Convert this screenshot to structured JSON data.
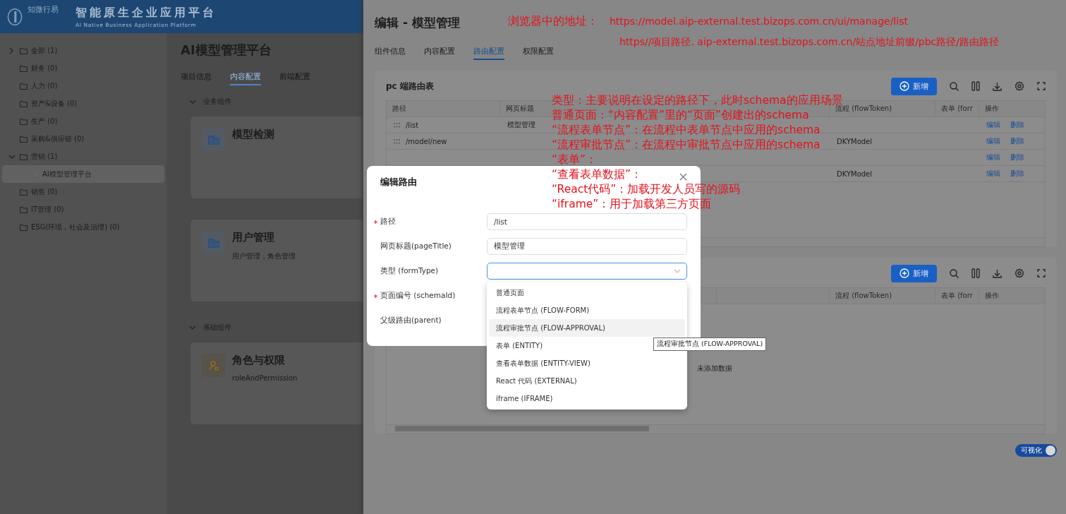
{
  "app_header": {
    "brand": "知微行易",
    "title": "智能原生企业应用平台",
    "subtitle": "AI Native Business Application Platform"
  },
  "sidebar": {
    "items": [
      {
        "label": "全部 (1)",
        "expanded": false
      },
      {
        "label": "财务 (0)"
      },
      {
        "label": "人力 (0)"
      },
      {
        "label": "资产&设备 (0)"
      },
      {
        "label": "生产 (0)"
      },
      {
        "label": "采购&供应链 (0)"
      },
      {
        "label": "营销 (1)",
        "expanded": true,
        "children": [
          {
            "label": "AI模型管理平台",
            "selected": true
          }
        ]
      },
      {
        "label": "销售 (0)"
      },
      {
        "label": "IT管理 (0)"
      },
      {
        "label": "ESG(环境，社会及治理) (0)"
      }
    ]
  },
  "page": {
    "title": "AI模型管理平台",
    "tabs": [
      {
        "label": "项目信息",
        "selected": false
      },
      {
        "label": "内容配置",
        "selected": true
      },
      {
        "label": "前端配置",
        "selected": false
      }
    ],
    "sections": [
      {
        "title": "业务组件",
        "expanded": true,
        "cards": [
          {
            "title": "模型检测"
          },
          {
            "title": "用户管理",
            "description": "用户管理，角色管理"
          }
        ]
      },
      {
        "title": "基础组件",
        "expanded": true,
        "cards": [
          {
            "title": "角色与权限",
            "description": "roleAndPermission"
          }
        ]
      }
    ]
  },
  "drawer": {
    "title": "编辑 - 模型管理",
    "tabs": [
      {
        "label": "组件信息",
        "selected": false
      },
      {
        "label": "内容配置",
        "selected": false
      },
      {
        "label": "路由配置",
        "selected": true
      },
      {
        "label": "权限配置",
        "selected": false
      }
    ],
    "route_tables": [
      {
        "title": "pc 端路由表",
        "add_button": "新增",
        "columns": [
          "路径",
          "网页标题",
          null,
          null,
          "流程 (flowToken)",
          "表单 (forr",
          "操作"
        ],
        "rows": [
          {
            "cells": [
              "/list",
              "模型管理",
              null,
              null,
              null,
              null
            ],
            "actions": [
              "编辑",
              "删除"
            ]
          },
          {
            "cells": [
              "/model/new",
              null,
              null,
              null,
              "DKYModel",
              null
            ],
            "actions": [
              "编辑",
              "删除"
            ]
          },
          {
            "cells": [
              null,
              null,
              null,
              null,
              null,
              null
            ],
            "actions": [
              "编辑",
              "删除"
            ]
          },
          {
            "cells": [
              null,
              null,
              null,
              null,
              "DKYModel",
              null
            ],
            "actions": [
              "编辑",
              "删除"
            ]
          }
        ]
      },
      {
        "add_button": "新增",
        "columns": [
          null,
          null,
          null,
          null,
          "流程 (flowToken)",
          "表单 (forr",
          "操作"
        ],
        "empty_text": "未添加数据"
      }
    ],
    "visual_toggle": {
      "label": "可视化",
      "on": true
    }
  },
  "modal": {
    "title": "编辑路由",
    "fields": [
      {
        "label": "路径",
        "required": true,
        "kind": "input",
        "value": "/list"
      },
      {
        "label": "网页标题(pageTitle)",
        "required": false,
        "kind": "input",
        "value": "模型管理"
      },
      {
        "label": "类型 (formType)",
        "required": false,
        "kind": "select",
        "focused": true
      },
      {
        "label": "页面编号 (schemaId)",
        "required": true
      },
      {
        "label": "父级路由(parent)",
        "required": false
      }
    ],
    "dropdown": {
      "options": [
        {
          "label": "普通页面",
          "hovered": false
        },
        {
          "label": "流程表单节点 (FLOW-FORM)",
          "hovered": false
        },
        {
          "label": "流程审批节点 (FLOW-APPROVAL)",
          "hovered": true
        },
        {
          "label": "表单 (ENTITY)",
          "hovered": false
        },
        {
          "label": "查看表单数据 (ENTITY-VIEW)",
          "hovered": false
        },
        {
          "label": "React 代码 (EXTERNAL)",
          "hovered": false
        },
        {
          "label": "iframe (IFRAME)",
          "hovered": false
        }
      ]
    },
    "tooltip": "流程审批节点 (FLOW-APPROVAL)"
  },
  "annotations": {
    "url_note": {
      "label": "浏览器中的地址：",
      "url": "https://model.aip-external.test.bizops.com.cn/ui/manage/list",
      "pattern": "https//项目路径. aip-external.test.bizops.com.cn/站点地址前缀/pbc路径/路由路径"
    },
    "type_notes": [
      "类型：主要说明在设定的路径下，此时schema的应用场景",
      "普通页面：“内容配置”里的“页面”创建出的schema",
      "“流程表单节点”：在流程中表单节点中应用的schema",
      "“流程审批节点”：在流程中审批节点中应用的schema",
      "“表单”：",
      "“查看表单数据”：",
      "“React代码”：加载开发人员写的源码",
      "“iframe”：用于加载第三方页面"
    ]
  }
}
